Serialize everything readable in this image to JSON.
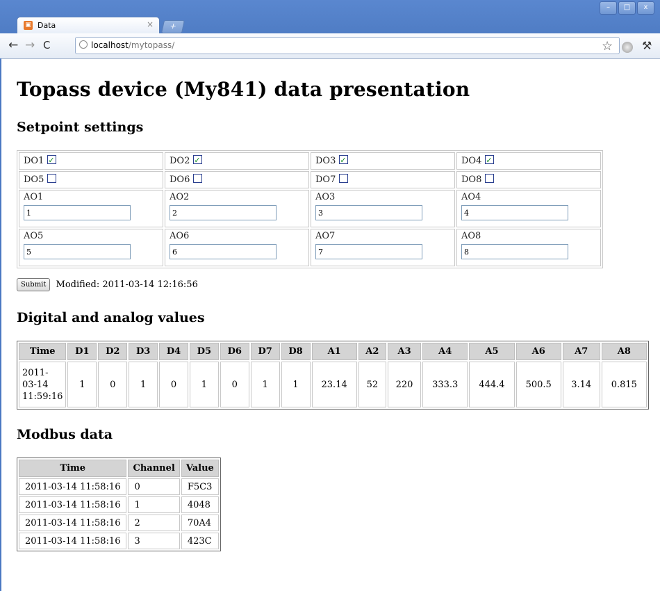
{
  "browser": {
    "tab_title": "Data",
    "tab_close": "×",
    "new_tab": "+",
    "window_controls": [
      "–",
      "□",
      "x"
    ],
    "url_host": "localhost",
    "url_path": "/mytopass/",
    "back": "←",
    "forward": "→",
    "reload": "C",
    "star": "☆",
    "wrench": "🔧"
  },
  "page": {
    "title": "Topass device (My841) data presentation",
    "setpoint_heading": "Setpoint settings",
    "digital_heading": "Digital and analog values",
    "modbus_heading": "Modbus data"
  },
  "setpoints": {
    "digital_outputs": [
      {
        "label": "DO1",
        "checked": true
      },
      {
        "label": "DO2",
        "checked": true
      },
      {
        "label": "DO3",
        "checked": true
      },
      {
        "label": "DO4",
        "checked": true
      },
      {
        "label": "DO5",
        "checked": false
      },
      {
        "label": "DO6",
        "checked": false
      },
      {
        "label": "DO7",
        "checked": false
      },
      {
        "label": "DO8",
        "checked": false
      }
    ],
    "analog_outputs": [
      {
        "label": "AO1",
        "value": "1"
      },
      {
        "label": "AO2",
        "value": "2"
      },
      {
        "label": "AO3",
        "value": "3"
      },
      {
        "label": "AO4",
        "value": "4"
      },
      {
        "label": "AO5",
        "value": "5"
      },
      {
        "label": "AO6",
        "value": "6"
      },
      {
        "label": "AO7",
        "value": "7"
      },
      {
        "label": "AO8",
        "value": "8"
      }
    ],
    "submit_label": "Submit",
    "modified_text": "Modified: 2011-03-14 12:16:56"
  },
  "values_table": {
    "headers": [
      "Time",
      "D1",
      "D2",
      "D3",
      "D4",
      "D5",
      "D6",
      "D7",
      "D8",
      "A1",
      "A2",
      "A3",
      "A4",
      "A5",
      "A6",
      "A7",
      "A8"
    ],
    "row": [
      "2011-\n03-14\n11:59:16",
      "1",
      "0",
      "1",
      "0",
      "1",
      "0",
      "1",
      "1",
      "23.14",
      "52",
      "220",
      "333.3",
      "444.4",
      "500.5",
      "3.14",
      "0.815"
    ]
  },
  "modbus_table": {
    "headers": [
      "Time",
      "Channel",
      "Value"
    ],
    "rows": [
      [
        "2011-03-14 11:58:16",
        "0",
        "F5C3"
      ],
      [
        "2011-03-14 11:58:16",
        "1",
        "4048"
      ],
      [
        "2011-03-14 11:58:16",
        "2",
        "70A4"
      ],
      [
        "2011-03-14 11:58:16",
        "3",
        "423C"
      ]
    ]
  }
}
